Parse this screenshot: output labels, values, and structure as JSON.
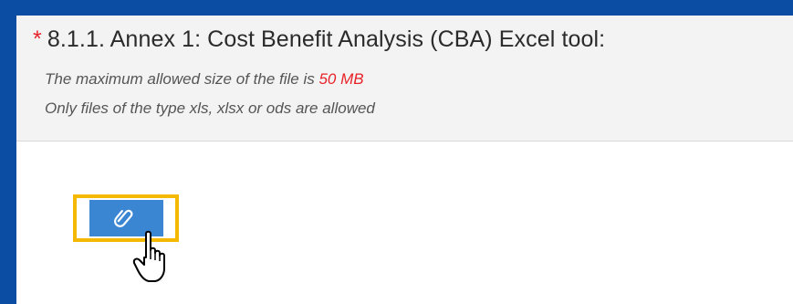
{
  "field": {
    "required_marker": "*",
    "title": "8.1.1. Annex 1: Cost Benefit Analysis (CBA) Excel tool:",
    "size_hint_prefix": "The maximum allowed size of the file is",
    "size_limit": "50 MB",
    "type_hint": "Only files of the type xls, xlsx or ods are allowed"
  },
  "upload": {
    "button_icon": "paperclip-icon",
    "cursor_icon": "hand-pointer-icon"
  },
  "colors": {
    "page_background": "#0a4da3",
    "header_background": "#f3f3f3",
    "required_star": "#e8232a",
    "size_limit": "#e8232a",
    "button": "#3b86d3",
    "highlight_frame": "#f5b800"
  }
}
